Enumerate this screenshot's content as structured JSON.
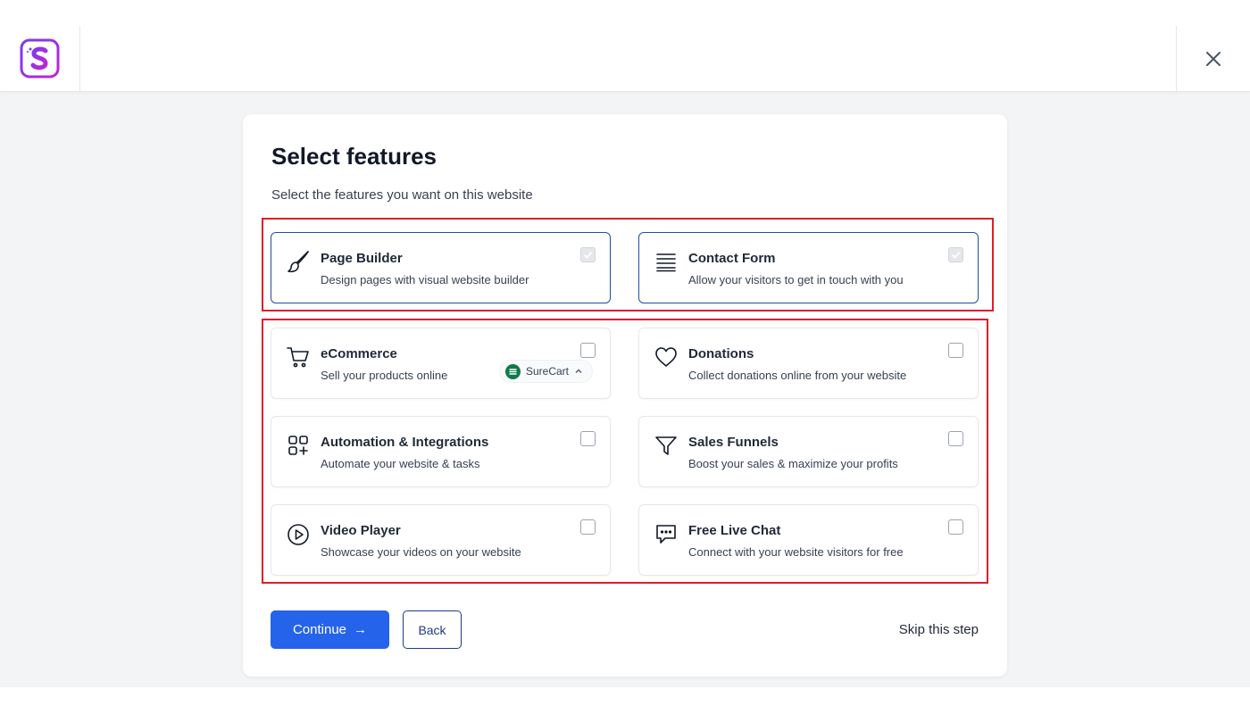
{
  "header": {
    "logo_letter": "S",
    "close_icon": "close-icon"
  },
  "panel": {
    "title": "Select features",
    "subtitle": "Select the features you want on this website"
  },
  "features": [
    {
      "title": "Page Builder",
      "description": "Design pages with visual website builder",
      "icon": "paintbrush-icon",
      "checked": true
    },
    {
      "title": "Contact Form",
      "description": "Allow your visitors to get in touch with you",
      "icon": "form-lines-icon",
      "checked": true
    },
    {
      "title": "eCommerce",
      "description": "Sell your products online",
      "icon": "cart-icon",
      "checked": false,
      "plugin": "SureCart"
    },
    {
      "title": "Donations",
      "description": "Collect donations online from your website",
      "icon": "heart-icon",
      "checked": false
    },
    {
      "title": "Automation & Integrations",
      "description": "Automate your website & tasks",
      "icon": "integrations-icon",
      "checked": false
    },
    {
      "title": "Sales Funnels",
      "description": "Boost your sales & maximize your profits",
      "icon": "funnel-icon",
      "checked": false
    },
    {
      "title": "Video Player",
      "description": "Showcase your videos on your website",
      "icon": "play-icon",
      "checked": false
    },
    {
      "title": "Free Live Chat",
      "description": "Connect with your website visitors for free",
      "icon": "chat-icon",
      "checked": false
    }
  ],
  "actions": {
    "continue_label": "Continue",
    "continue_arrow": "→",
    "back_label": "Back",
    "skip_label": "Skip this step"
  },
  "colors": {
    "primary": "#2563eb",
    "highlight": "#e11d2a",
    "selected_border": "#1e4fa8",
    "surecart_green": "#0f7a4a"
  }
}
